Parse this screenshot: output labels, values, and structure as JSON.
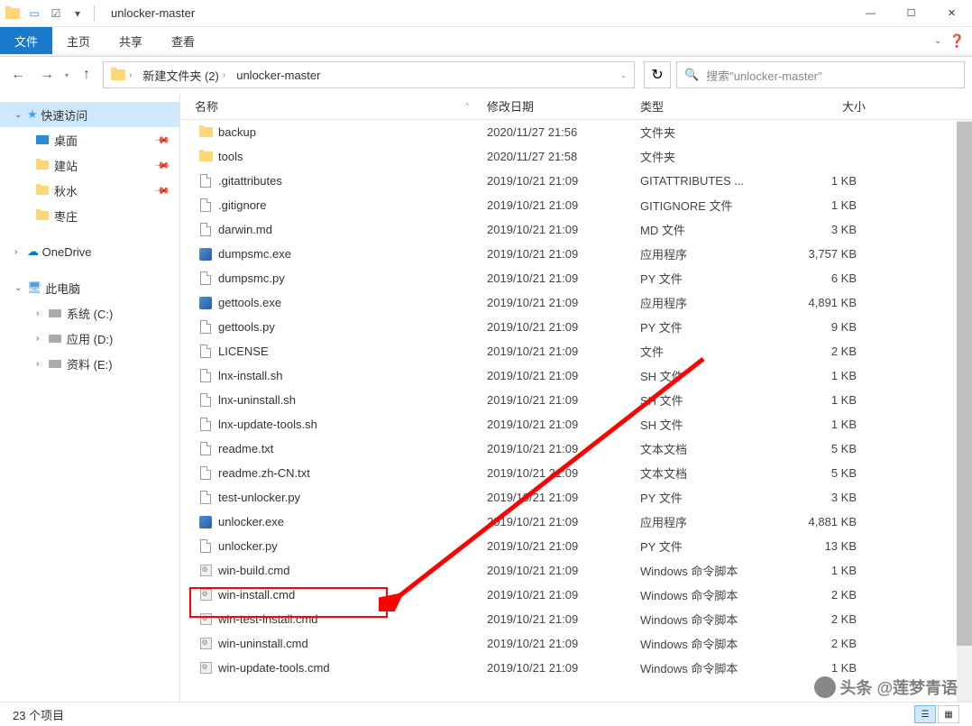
{
  "title": "unlocker-master",
  "tabs": {
    "file": "文件",
    "home": "主页",
    "share": "共享",
    "view": "查看"
  },
  "breadcrumb": [
    "新建文件夹 (2)",
    "unlocker-master"
  ],
  "search_placeholder": "搜索\"unlocker-master\"",
  "columns": {
    "name": "名称",
    "date": "修改日期",
    "type": "类型",
    "size": "大小"
  },
  "nav": {
    "quick": "快速访问",
    "desktop": "桌面",
    "jianzhan": "建站",
    "qiushui": "秋水",
    "zaozhuang": "枣庄",
    "onedrive": "OneDrive",
    "thispc": "此电脑",
    "sys": "系统 (C:)",
    "app": "应用 (D:)",
    "data": "资料 (E:)"
  },
  "files": [
    {
      "ico": "folder",
      "name": "backup",
      "date": "2020/11/27 21:56",
      "type": "文件夹",
      "size": ""
    },
    {
      "ico": "folder",
      "name": "tools",
      "date": "2020/11/27 21:58",
      "type": "文件夹",
      "size": ""
    },
    {
      "ico": "file",
      "name": ".gitattributes",
      "date": "2019/10/21 21:09",
      "type": "GITATTRIBUTES ...",
      "size": "1 KB"
    },
    {
      "ico": "file",
      "name": ".gitignore",
      "date": "2019/10/21 21:09",
      "type": "GITIGNORE 文件",
      "size": "1 KB"
    },
    {
      "ico": "file",
      "name": "darwin.md",
      "date": "2019/10/21 21:09",
      "type": "MD 文件",
      "size": "3 KB"
    },
    {
      "ico": "exe",
      "name": "dumpsmc.exe",
      "date": "2019/10/21 21:09",
      "type": "应用程序",
      "size": "3,757 KB"
    },
    {
      "ico": "file",
      "name": "dumpsmc.py",
      "date": "2019/10/21 21:09",
      "type": "PY 文件",
      "size": "6 KB"
    },
    {
      "ico": "exe",
      "name": "gettools.exe",
      "date": "2019/10/21 21:09",
      "type": "应用程序",
      "size": "4,891 KB"
    },
    {
      "ico": "file",
      "name": "gettools.py",
      "date": "2019/10/21 21:09",
      "type": "PY 文件",
      "size": "9 KB"
    },
    {
      "ico": "file",
      "name": "LICENSE",
      "date": "2019/10/21 21:09",
      "type": "文件",
      "size": "2 KB"
    },
    {
      "ico": "file",
      "name": "lnx-install.sh",
      "date": "2019/10/21 21:09",
      "type": "SH 文件",
      "size": "1 KB"
    },
    {
      "ico": "file",
      "name": "lnx-uninstall.sh",
      "date": "2019/10/21 21:09",
      "type": "SH 文件",
      "size": "1 KB"
    },
    {
      "ico": "file",
      "name": "lnx-update-tools.sh",
      "date": "2019/10/21 21:09",
      "type": "SH 文件",
      "size": "1 KB"
    },
    {
      "ico": "file",
      "name": "readme.txt",
      "date": "2019/10/21 21:09",
      "type": "文本文档",
      "size": "5 KB"
    },
    {
      "ico": "file",
      "name": "readme.zh-CN.txt",
      "date": "2019/10/21 21:09",
      "type": "文本文档",
      "size": "5 KB"
    },
    {
      "ico": "file",
      "name": "test-unlocker.py",
      "date": "2019/10/21 21:09",
      "type": "PY 文件",
      "size": "3 KB"
    },
    {
      "ico": "exe",
      "name": "unlocker.exe",
      "date": "2019/10/21 21:09",
      "type": "应用程序",
      "size": "4,881 KB"
    },
    {
      "ico": "file",
      "name": "unlocker.py",
      "date": "2019/10/21 21:09",
      "type": "PY 文件",
      "size": "13 KB"
    },
    {
      "ico": "cmd",
      "name": "win-build.cmd",
      "date": "2019/10/21 21:09",
      "type": "Windows 命令脚本",
      "size": "1 KB"
    },
    {
      "ico": "cmd",
      "name": "win-install.cmd",
      "date": "2019/10/21 21:09",
      "type": "Windows 命令脚本",
      "size": "2 KB"
    },
    {
      "ico": "cmd",
      "name": "win-test-install.cmd",
      "date": "2019/10/21 21:09",
      "type": "Windows 命令脚本",
      "size": "2 KB"
    },
    {
      "ico": "cmd",
      "name": "win-uninstall.cmd",
      "date": "2019/10/21 21:09",
      "type": "Windows 命令脚本",
      "size": "2 KB"
    },
    {
      "ico": "cmd",
      "name": "win-update-tools.cmd",
      "date": "2019/10/21 21:09",
      "type": "Windows 命令脚本",
      "size": "1 KB"
    }
  ],
  "status": "23 个项目",
  "watermark": "头条 @莲梦青语"
}
